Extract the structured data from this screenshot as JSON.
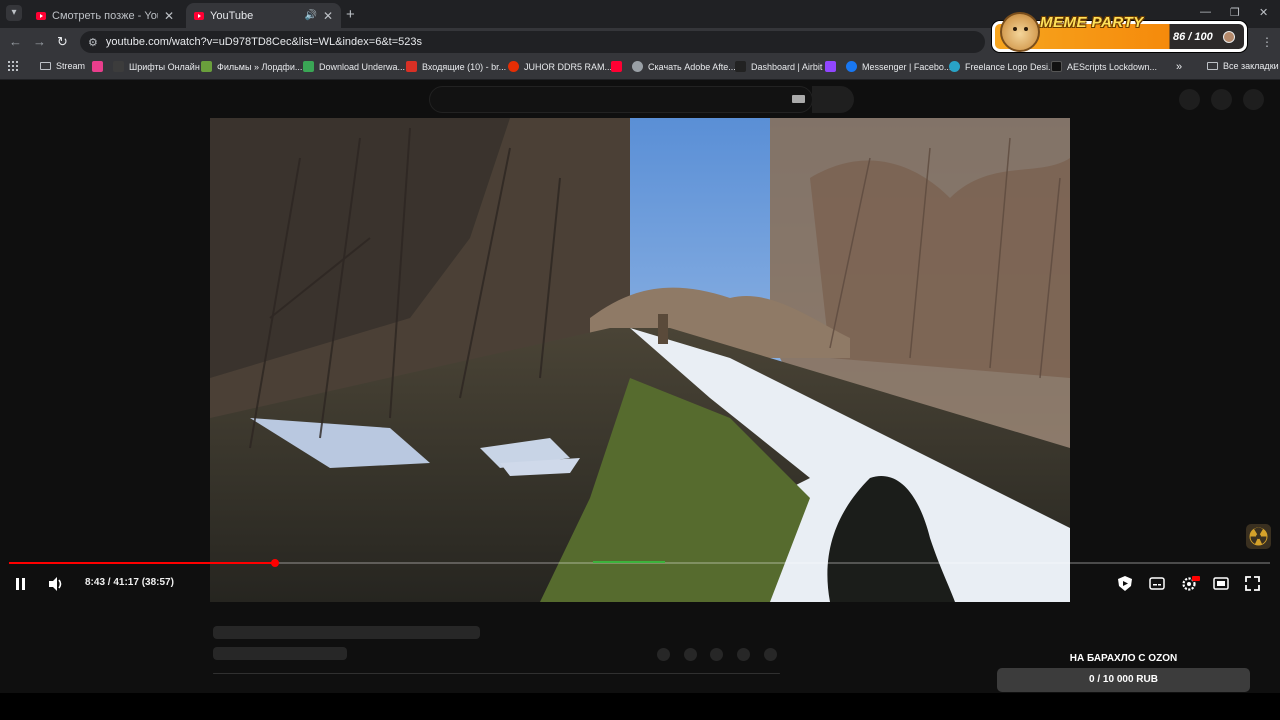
{
  "browser": {
    "tabs": [
      {
        "title": "Смотреть позже - YouTube",
        "active": false
      },
      {
        "title": "YouTube",
        "active": true
      }
    ],
    "url": "youtube.com/watch?v=uD978TD8Cec&list=WL&index=6&t=523s",
    "bookmarks": [
      {
        "label": "Stream",
        "icon": "folder-icon"
      },
      {
        "label": "",
        "icon": "bookmark-red-icon",
        "color": "#e83e8c"
      },
      {
        "label": "Шрифты Онлайн",
        "icon": "font-icon"
      },
      {
        "label": "Фильмы » Лордфи...",
        "icon": "film-icon",
        "color": "#6a9f3c"
      },
      {
        "label": "Download Underwa...",
        "icon": "download-icon",
        "color": "#3aa655"
      },
      {
        "label": "Входящие (10) - br...",
        "icon": "gmail-icon",
        "color": "#d93025"
      },
      {
        "label": "JUHOR DDR5 RAM...",
        "icon": "aliexpress-icon",
        "color": "#e62e04"
      },
      {
        "label": "",
        "icon": "youtube-icon",
        "color": "#ff0033"
      },
      {
        "label": "Скачать Adobe Afte...",
        "icon": "globe-icon",
        "color": "#9aa0a6"
      },
      {
        "label": "Dashboard | Airbit",
        "icon": "airbit-icon",
        "color": "#222222"
      },
      {
        "label": "",
        "icon": "twitch-icon",
        "color": "#9146ff"
      },
      {
        "label": "Messenger | Facebo...",
        "icon": "facebook-icon",
        "color": "#1877f2"
      },
      {
        "label": "Freelance Logo Desi...",
        "icon": "freelance-icon",
        "color": "#29a3c6"
      },
      {
        "label": "AEScripts Lockdown...",
        "icon": "aescripts-icon",
        "color": "#111111"
      }
    ],
    "all_bookmarks_label": "Все закладки"
  },
  "meme_party": {
    "title": "MEME PARTY",
    "count": "86 / 100",
    "progress_fraction": 0.86
  },
  "player": {
    "time": "8:43 / 41:17 (38:57)",
    "progress_fraction": 0.211,
    "state": "playing"
  },
  "donation": {
    "title": "НА БАРАХЛО С OZON",
    "amount": "0 / 10 000 RUB"
  }
}
